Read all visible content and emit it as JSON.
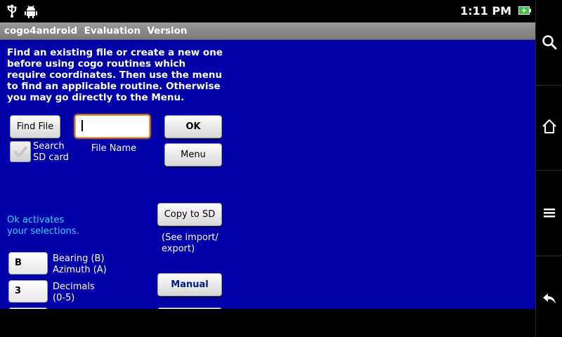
{
  "status_bar": {
    "time": "1:11 PM",
    "icons": [
      "usb-icon",
      "android-debug-icon",
      "battery-charging-icon"
    ]
  },
  "title_bar": {
    "title": "cogo4android  Evaluation  Version"
  },
  "intro_text": "Find an existing file or create a new one before using cogo routines which require coordinates. Then use the menu to find an applicable routine. Otherwise you may go directly to the Menu.",
  "buttons": {
    "find_file": "Find File",
    "ok": "OK",
    "menu": "Menu",
    "copy_to_sd": "Copy to SD",
    "manual": "Manual"
  },
  "file_name_input": {
    "value": "",
    "label": "File Name"
  },
  "search_sd": {
    "label_line1": "Search",
    "label_line2": "SD card",
    "checked": true
  },
  "copy_note": {
    "line1": "(See import/",
    "line2": "export)"
  },
  "hint": {
    "line1": "Ok activates",
    "line2": "your selections."
  },
  "settings": {
    "bearing": {
      "value": "B",
      "label_line1": "Bearing (B)",
      "label_line2": "Azimuth (A)"
    },
    "decimals": {
      "value": "3",
      "label_line1": "Decimals",
      "label_line2": "(0-5)"
    }
  },
  "nav_bar": {
    "items": [
      "search-icon",
      "home-icon",
      "menu-icon",
      "back-icon"
    ]
  },
  "colors": {
    "background": "#0000a8",
    "hint_text": "#33d4ff",
    "focus_border": "#f39b2a",
    "status_bar": "#000000"
  }
}
